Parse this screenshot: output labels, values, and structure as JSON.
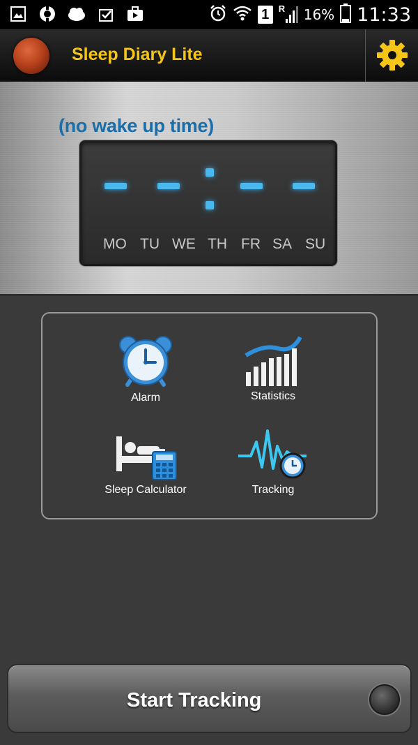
{
  "status_bar": {
    "battery_percent": "16%",
    "time": "11:33",
    "sim_slot": "1",
    "roaming": "R",
    "icons": [
      "gallery-icon",
      "lifebuoy-icon",
      "weather-icon",
      "clipboard-check-icon",
      "video-briefcase-icon",
      "alarm-icon",
      "wifi-icon",
      "sim-icon",
      "signal-icon",
      "battery-icon"
    ]
  },
  "header": {
    "title": "Sleep Diary Lite",
    "title_color": "#f5c518",
    "settings_icon": "gear-icon"
  },
  "wake_panel": {
    "label": "(no wake up time)",
    "label_color": "#1c6ea8",
    "lcd_color": "#4ab8ec",
    "days": [
      "MO",
      "TU",
      "WE",
      "TH",
      "FR",
      "SA",
      "SU"
    ]
  },
  "menu": {
    "items": [
      {
        "label": "Alarm",
        "icon": "alarm-clock-icon"
      },
      {
        "label": "Statistics",
        "icon": "statistics-icon"
      },
      {
        "label": "Sleep Calculator",
        "icon": "sleep-calculator-icon"
      },
      {
        "label": "Tracking",
        "icon": "tracking-icon"
      }
    ]
  },
  "start_button": {
    "label": "Start Tracking",
    "indicator": "indicator-light-icon"
  }
}
